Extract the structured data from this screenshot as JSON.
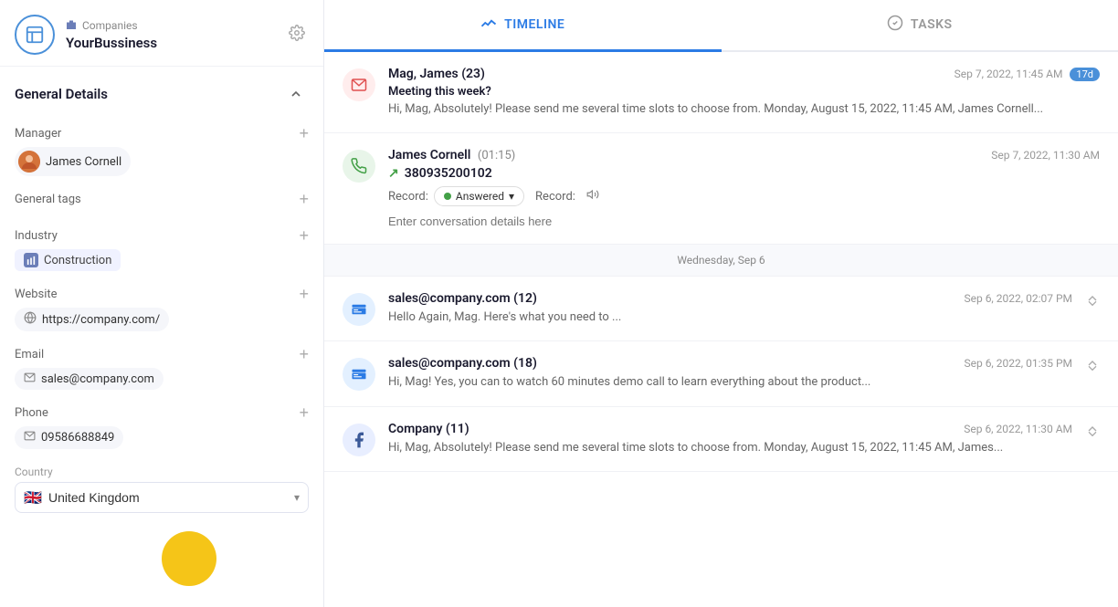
{
  "sidebar": {
    "breadcrumb": "Companies",
    "company_name": "YourBussiness",
    "section_title": "General Details",
    "manager_label": "Manager",
    "manager_name": "James Cornell",
    "general_tags_label": "General tags",
    "industry_label": "Industry",
    "industry_value": "Construction",
    "website_label": "Website",
    "website_value": "https://company.com/",
    "email_label": "Email",
    "email_value": "sales@company.com",
    "phone_label": "Phone",
    "phone_value": "09586688849",
    "country_label": "Country",
    "country_value": "United Kingdom",
    "country_flag": "🇬🇧"
  },
  "tabs": [
    {
      "id": "timeline",
      "label": "TIMELINE",
      "icon": "📈",
      "active": true
    },
    {
      "id": "tasks",
      "label": "TASKS",
      "icon": "✅",
      "active": false
    }
  ],
  "timeline": {
    "date_separator": "Wednesday, Sep 6",
    "items": [
      {
        "id": "email-1",
        "type": "email",
        "sender": "Mag, James (23)",
        "timestamp": "Sep 7, 2022, 11:45 AM",
        "badge": "17d",
        "subject": "Meeting this week?",
        "preview": "Hi, Mag, Absolutely! Please send me several time slots to choose from. Monday, August 15, 2022, 11:45 AM, James Cornell..."
      },
      {
        "id": "call-1",
        "type": "call",
        "sender": "James Cornell",
        "duration": "(01:15)",
        "timestamp": "Sep 7, 2022, 11:30 AM",
        "phone_number": "380935200102",
        "status": "Answered",
        "record_label": "Record:",
        "input_placeholder": "Enter conversation details here"
      },
      {
        "id": "email-2",
        "type": "email-blue",
        "sender": "sales@company.com (12)",
        "timestamp": "Sep 6, 2022, 02:07 PM",
        "preview": "Hello Again, Mag. Here's what you need to ..."
      },
      {
        "id": "email-3",
        "type": "email-blue",
        "sender": "sales@company.com (18)",
        "timestamp": "Sep 6, 2022, 01:35 PM",
        "preview": "Hi, Mag! Yes, you can to watch 60 minutes demo call to learn everything about the product..."
      },
      {
        "id": "company-1",
        "type": "facebook",
        "sender": "Company (11)",
        "timestamp": "Sep 6, 2022, 11:30 AM",
        "preview": "Hi, Mag, Absolutely! Please send me several time slots to choose from. Monday, August 15, 2022, 11:45 AM, James..."
      }
    ]
  },
  "icons": {
    "gear": "⚙",
    "collapse": "∧",
    "add": "+",
    "globe": "⊙",
    "envelope": "✉",
    "phone": "✉",
    "chevron_down": "▾",
    "call_outgoing": "↗",
    "volume": "🔊",
    "expand": "⇕",
    "buildings": "🏢",
    "timeline_icon": "〰",
    "tasks_icon": "○"
  }
}
